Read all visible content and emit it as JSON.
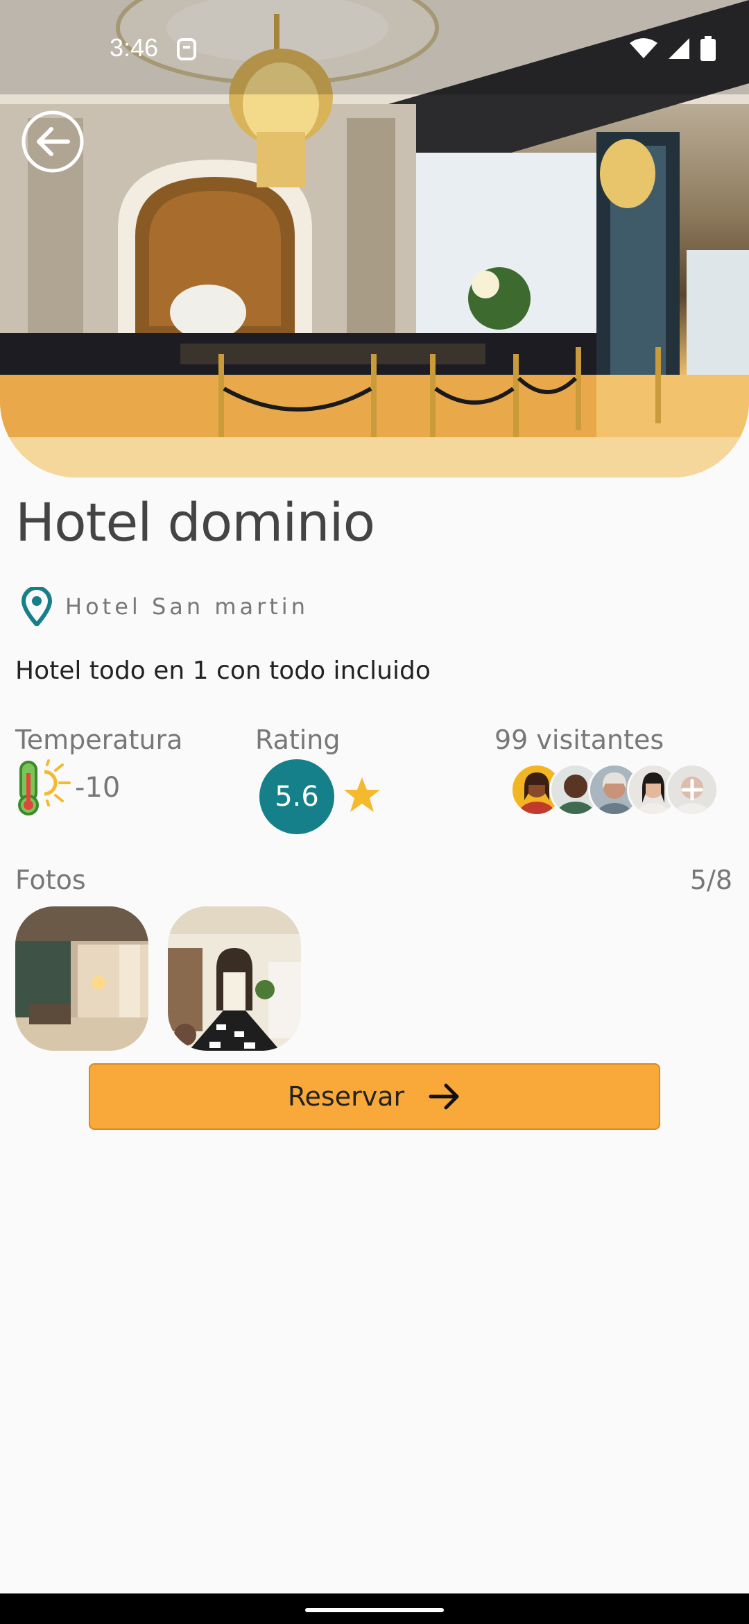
{
  "status_bar": {
    "time": "3:46",
    "icons": [
      "notification-icon",
      "wifi-icon",
      "signal-icon",
      "battery-icon"
    ]
  },
  "hero": {
    "image": "hotel-lobby-photo",
    "back_icon": "arrow-back-circle-icon"
  },
  "hotel": {
    "title": "Hotel dominio",
    "location_icon": "map-pin-icon",
    "location": "Hotel San martin",
    "description": "Hotel todo en 1 con todo incluido"
  },
  "stats": {
    "temperature_label": "Temperatura",
    "temperature_icon": "thermometer-sun-icon",
    "temperature_value": "-10",
    "rating_label": "Rating",
    "rating_value": "5.6",
    "rating_icon": "star-icon",
    "visitors_label": "99 visitantes",
    "visitor_avatars": 5
  },
  "photos": {
    "label": "Fotos",
    "count": "5/8",
    "thumbnails": [
      "lobby-photo-1",
      "hallway-photo-2"
    ]
  },
  "actions": {
    "reserve_label": "Reservar",
    "reserve_icon": "arrow-right-icon"
  },
  "colors": {
    "accent_teal": "#15808a",
    "button_orange": "#f8a93a",
    "star_yellow": "#f5b92e",
    "background": "#fafafa"
  }
}
